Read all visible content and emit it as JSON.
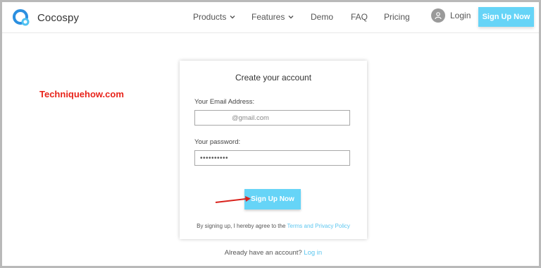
{
  "nav": {
    "brand": "Cocospy",
    "items": [
      {
        "label": "Products",
        "has_dropdown": true
      },
      {
        "label": "Features",
        "has_dropdown": true
      },
      {
        "label": "Demo",
        "has_dropdown": false
      },
      {
        "label": "FAQ",
        "has_dropdown": false
      },
      {
        "label": "Pricing",
        "has_dropdown": false
      }
    ],
    "login_label": "Login",
    "signup_label": "Sign Up Now"
  },
  "watermark": "Techniquehow.com",
  "form": {
    "title": "Create your account",
    "email_label": "Your Email Address:",
    "email_value": "@gmail.com",
    "password_label": "Your password:",
    "password_value": "••••••••••",
    "submit_label": "Sign Up Now",
    "terms_prefix": "By signing up, I hereby agree to the",
    "terms_link": "Terms and Privacy Policy"
  },
  "footer": {
    "already_text": "Already have an account?",
    "login_link": "Log in"
  },
  "colors": {
    "accent": "#66d4f7",
    "link": "#5cc6ef",
    "watermark": "#e8231a",
    "arrow": "#d9231d"
  },
  "icons": {
    "logo": "cocospy-logo-icon",
    "user": "user-icon",
    "chevron": "chevron-down-icon",
    "annotation": "red-arrow-icon"
  }
}
